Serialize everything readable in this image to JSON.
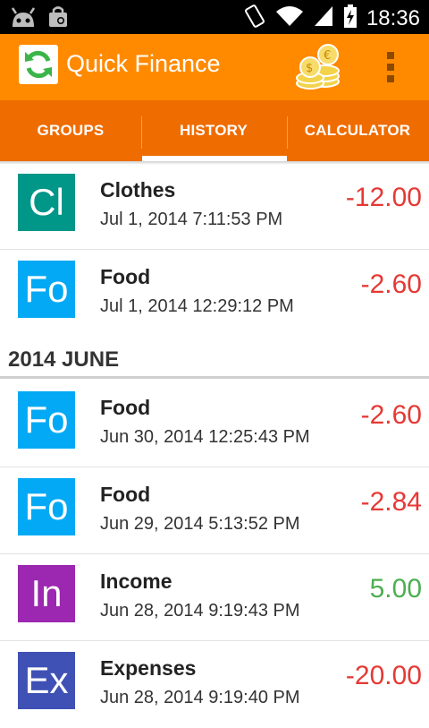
{
  "status_bar": {
    "time": "18:36",
    "icons": [
      "android-debug-icon",
      "shopping-bag-icon",
      "vibrate-icon",
      "wifi-icon",
      "signal-icon",
      "battery-charging-icon"
    ]
  },
  "action_bar": {
    "title": "Quick Finance",
    "app_icon": "sync-icon",
    "coins_icon": "coins-icon",
    "overflow_icon": "overflow-menu-icon"
  },
  "tabs": [
    {
      "label": "GROUPS",
      "selected": false
    },
    {
      "label": "HISTORY",
      "selected": true
    },
    {
      "label": "CALCULATOR",
      "selected": false
    }
  ],
  "section_june": "2014 JUNE",
  "entries": [
    {
      "abbr": "Cl",
      "category": "Clothes",
      "date": "Jul 1, 2014 7:11:53 PM",
      "amount": "-12.00",
      "color": "#009688",
      "amount_color": "#e53935"
    },
    {
      "abbr": "Fo",
      "category": "Food",
      "date": "Jul 1, 2014 12:29:12 PM",
      "amount": "-2.60",
      "color": "#03a9f4",
      "amount_color": "#e53935"
    },
    {
      "abbr": "Fo",
      "category": "Food",
      "date": "Jun 30, 2014 12:25:43 PM",
      "amount": "-2.60",
      "color": "#03a9f4",
      "amount_color": "#e53935"
    },
    {
      "abbr": "Fo",
      "category": "Food",
      "date": "Jun 29, 2014 5:13:52 PM",
      "amount": "-2.84",
      "color": "#03a9f4",
      "amount_color": "#e53935"
    },
    {
      "abbr": "In",
      "category": "Income",
      "date": "Jun 28, 2014 9:19:43 PM",
      "amount": "5.00",
      "color": "#9c27b0",
      "amount_color": "#4caf50"
    },
    {
      "abbr": "Ex",
      "category": "Expenses",
      "date": "Jun 28, 2014 9:19:40 PM",
      "amount": "-20.00",
      "color": "#3f51b5",
      "amount_color": "#e53935"
    }
  ]
}
